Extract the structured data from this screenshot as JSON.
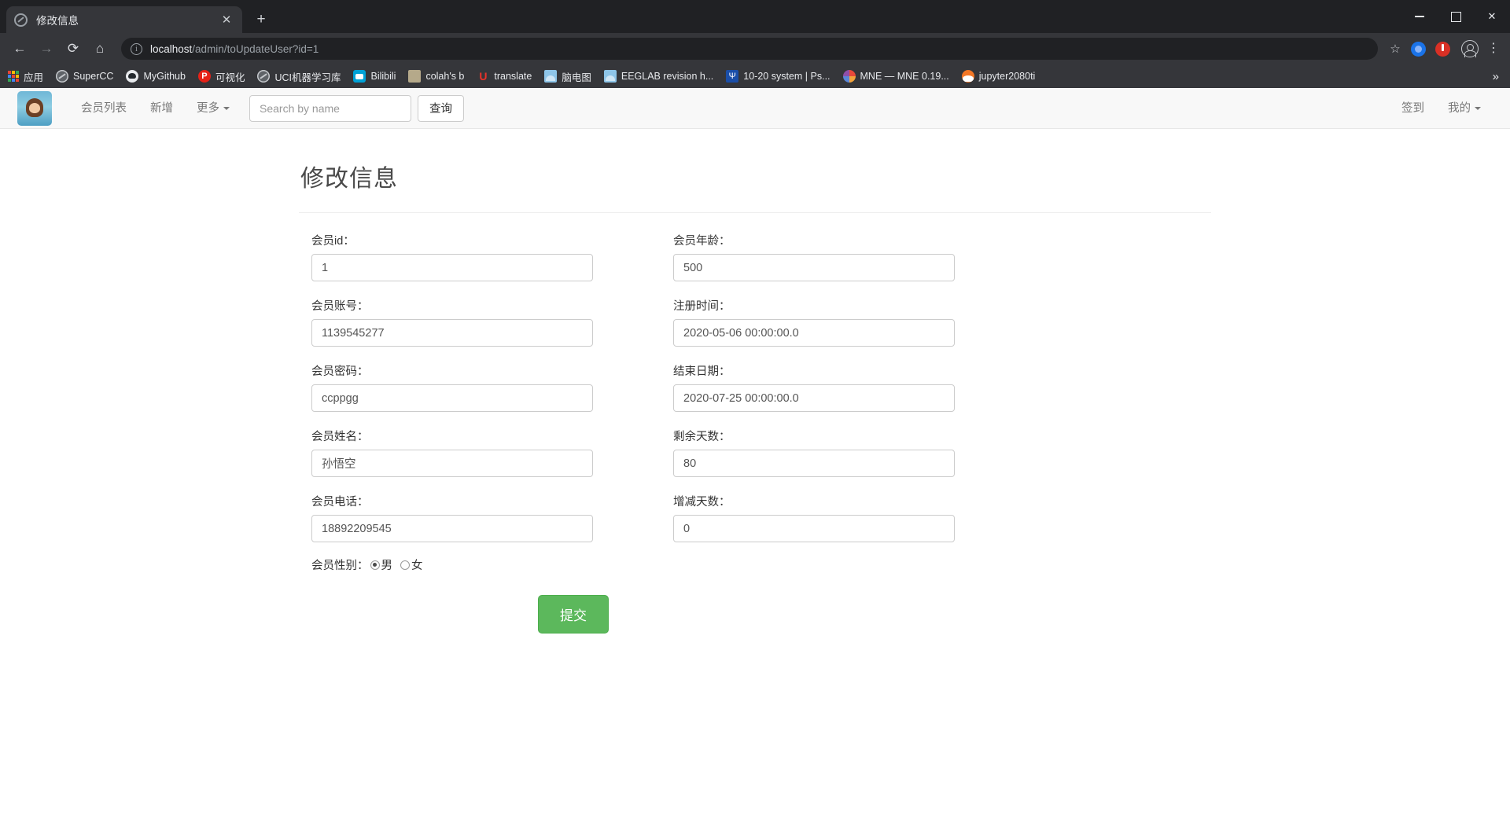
{
  "browser": {
    "tab": {
      "title": "修改信息",
      "favicon": "globe-icon",
      "close": "✕"
    },
    "new_tab": "+",
    "window_controls": {
      "minimize": "minimize-icon",
      "maximize": "maximize-icon",
      "close": "✕"
    },
    "nav": {
      "back": "←",
      "forward": "→",
      "reload": "⟳",
      "home": "⌂"
    },
    "omnibox": {
      "info_icon": "ⓘ",
      "url_host": "localhost",
      "url_path": "/admin/toUpdateUser?id=1",
      "star": "☆"
    },
    "toolbar_right": {
      "menu": "⋮"
    },
    "bookmarks": [
      {
        "label": "应用",
        "icon": "apps-grid-icon"
      },
      {
        "label": "SuperCC",
        "icon": "globe-icon"
      },
      {
        "label": "MyGithub",
        "icon": "github-icon"
      },
      {
        "label": "可视化",
        "icon": "p-letter-icon"
      },
      {
        "label": "UCI机器学习库",
        "icon": "globe-icon"
      },
      {
        "label": "Bilibili",
        "icon": "bilibili-icon"
      },
      {
        "label": "colah's b",
        "icon": "thumbnail-icon"
      },
      {
        "label": "translate",
        "icon": "u-letter-icon"
      },
      {
        "label": "脑电图",
        "icon": "brain-image-icon"
      },
      {
        "label": "EEGLAB revision h...",
        "icon": "brain-image-icon"
      },
      {
        "label": "10-20 system | Ps...",
        "icon": "psy-icon"
      },
      {
        "label": "MNE — MNE 0.19...",
        "icon": "mne-icon"
      },
      {
        "label": "jupyter2080ti",
        "icon": "jupyter-icon"
      }
    ],
    "bookmarks_overflow": "»"
  },
  "app": {
    "brand_logo": "site-logo",
    "nav_links": [
      {
        "label": "会员列表",
        "caret": false
      },
      {
        "label": "新增",
        "caret": false
      },
      {
        "label": "更多",
        "caret": true
      }
    ],
    "search": {
      "placeholder": "Search by name",
      "value": "",
      "button": "查询"
    },
    "nav_right": [
      {
        "label": "签到",
        "caret": false
      },
      {
        "label": "我的",
        "caret": true
      }
    ]
  },
  "main": {
    "title": "修改信息",
    "fields_left": [
      {
        "label": "会员id：",
        "value": "1"
      },
      {
        "label": "会员账号：",
        "value": "1139545277"
      },
      {
        "label": "会员密码：",
        "value": "ccppgg"
      },
      {
        "label": "会员姓名：",
        "value": "孙悟空"
      },
      {
        "label": "会员电话：",
        "value": "18892209545"
      }
    ],
    "fields_right": [
      {
        "label": "会员年龄：",
        "value": "500"
      },
      {
        "label": "注册时间：",
        "value": "2020-05-06 00:00:00.0"
      },
      {
        "label": "结束日期：",
        "value": "2020-07-25 00:00:00.0"
      },
      {
        "label": "剩余天数：",
        "value": "80"
      },
      {
        "label": "增减天数：",
        "value": "0"
      }
    ],
    "gender": {
      "label": "会员性别：",
      "options": [
        {
          "label": "男",
          "selected": true
        },
        {
          "label": "女",
          "selected": false
        }
      ]
    },
    "submit_label": "提交",
    "submit_color": "#5cb85c"
  }
}
